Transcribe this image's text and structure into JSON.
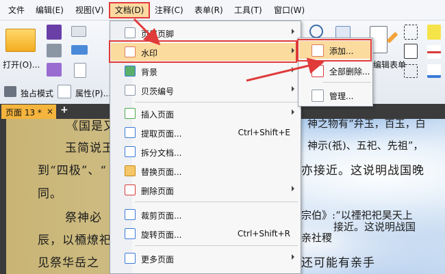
{
  "menubar": {
    "items": [
      "文件",
      "编辑(E)",
      "视图(V)",
      "文档(D)",
      "注释(C)",
      "表单(R)",
      "工具(T)",
      "窗口(W)"
    ],
    "active_index": 3
  },
  "ribbon": {
    "open_label": "打开(O)...",
    "exclusive_mode_label": "独占模式",
    "properties_label": "属性(P)...",
    "edit_form_label": "编辑表单"
  },
  "tab": {
    "label": "页面 13 *",
    "close": "×",
    "new": "+"
  },
  "document_menu": {
    "items": [
      {
        "label": "页眉页脚",
        "shortcut": "",
        "submenu": true
      },
      {
        "label": "水印",
        "shortcut": "",
        "submenu": true,
        "highlighted": true
      },
      {
        "label": "背景",
        "shortcut": "",
        "submenu": true
      },
      {
        "label": "贝茨编号",
        "shortcut": "",
        "submenu": true
      },
      {
        "label": "插入页面",
        "shortcut": "",
        "submenu": true
      },
      {
        "label": "提取页面...",
        "shortcut": "Ctrl+Shift+E",
        "submenu": false
      },
      {
        "label": "拆分文档...",
        "shortcut": "",
        "submenu": false
      },
      {
        "label": "替换页面...",
        "shortcut": "",
        "submenu": false
      },
      {
        "label": "删除页面",
        "shortcut": "",
        "submenu": true
      },
      {
        "label": "裁剪页面...",
        "shortcut": "",
        "submenu": false
      },
      {
        "label": "旋转页面...",
        "shortcut": "Ctrl+Shift+R",
        "submenu": false
      },
      {
        "label": "更多页面",
        "shortcut": "",
        "submenu": true
      }
    ]
  },
  "watermark_submenu": {
    "items": [
      "添加...",
      "全部删除...",
      "管理..."
    ],
    "highlighted_index": 0
  },
  "document_text": {
    "lines": [
      "《国是又',",
      "玉简说王",
      "到“四极”、“",
      "同。",
      "祭神必",
      "辰，以槱燎祀",
      "见祭华岳之",
      "神之物有“弁玉，百玉，白",
      "神示(祇)、五祀、先祖”，",
      "亦接近。这说明战国晚",
      "宗伯》:“以禋祀祀昊天上",
      "接近。这说明战国",
      "亲社稷",
      "还可能有亲手"
    ]
  },
  "colors": {
    "highlight_red": "#e03a3a",
    "menu_highlight": "#fbdb9e",
    "tab_orange": "#f4b43d"
  }
}
